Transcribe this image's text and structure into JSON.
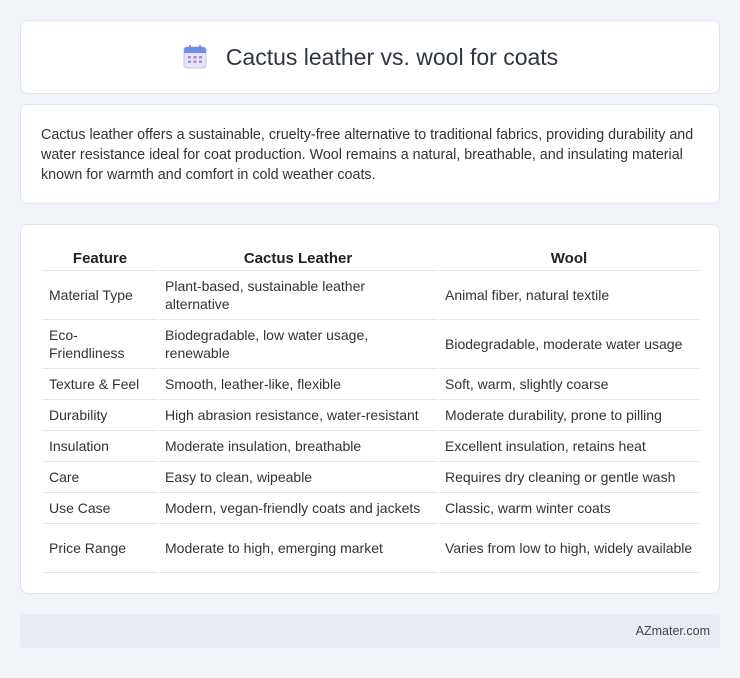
{
  "header": {
    "title": "Cactus leather vs. wool for coats",
    "icon": "calendar-icon"
  },
  "intro": {
    "text": "Cactus leather offers a sustainable, cruelty-free alternative to traditional fabrics, providing durability and water resistance ideal for coat production. Wool remains a natural, breathable, and insulating material known for warmth and comfort in cold weather coats."
  },
  "table": {
    "columns": [
      "Feature",
      "Cactus Leather",
      "Wool"
    ],
    "rows": [
      [
        "Material Type",
        "Plant-based, sustainable leather alternative",
        "Animal fiber, natural textile"
      ],
      [
        "Eco-Friendliness",
        "Biodegradable, low water usage, renewable",
        "Biodegradable, moderate water usage"
      ],
      [
        "Texture & Feel",
        "Smooth, leather-like, flexible",
        "Soft, warm, slightly coarse"
      ],
      [
        "Durability",
        "High abrasion resistance, water-resistant",
        "Moderate durability, prone to pilling"
      ],
      [
        "Insulation",
        "Moderate insulation, breathable",
        "Excellent insulation, retains heat"
      ],
      [
        "Care",
        "Easy to clean, wipeable",
        "Requires dry cleaning or gentle wash"
      ],
      [
        "Use Case",
        "Modern, vegan-friendly coats and jackets",
        "Classic, warm winter coats"
      ],
      [
        "Price Range",
        "Moderate to high, emerging market",
        "Varies from low to high, widely available"
      ]
    ]
  },
  "footer": {
    "brand": "AZmater.com"
  }
}
